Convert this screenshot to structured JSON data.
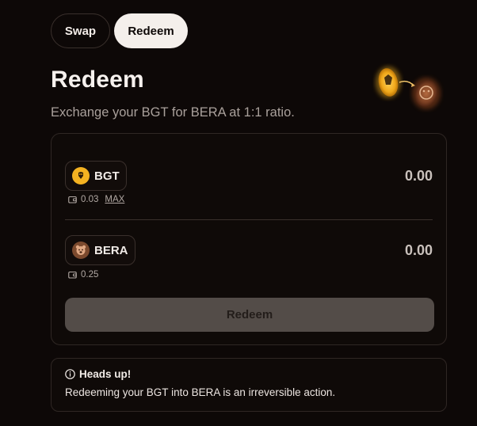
{
  "tabs": [
    {
      "label": "Swap",
      "active": false
    },
    {
      "label": "Redeem",
      "active": true
    }
  ],
  "page": {
    "title": "Redeem",
    "subtitle": "Exchange your BGT for BERA at 1:1 ratio."
  },
  "from_token": {
    "symbol": "BGT",
    "amount": "0.00",
    "balance": "0.03",
    "max_label": "MAX",
    "icon": "bgt-token-icon",
    "color": "#f4b221"
  },
  "to_token": {
    "symbol": "BERA",
    "amount": "0.00",
    "balance": "0.25",
    "icon": "bera-token-icon",
    "color": "#7c4a2e"
  },
  "actions": {
    "redeem_label": "Redeem"
  },
  "notice": {
    "title": "Heads up!",
    "body": "Redeeming your BGT into BERA is an irreversible action."
  },
  "colors": {
    "background": "#0d0807",
    "accent_gold": "#f4b221",
    "bera_brown": "#7c4a2e",
    "disabled_button": "#534c48"
  }
}
